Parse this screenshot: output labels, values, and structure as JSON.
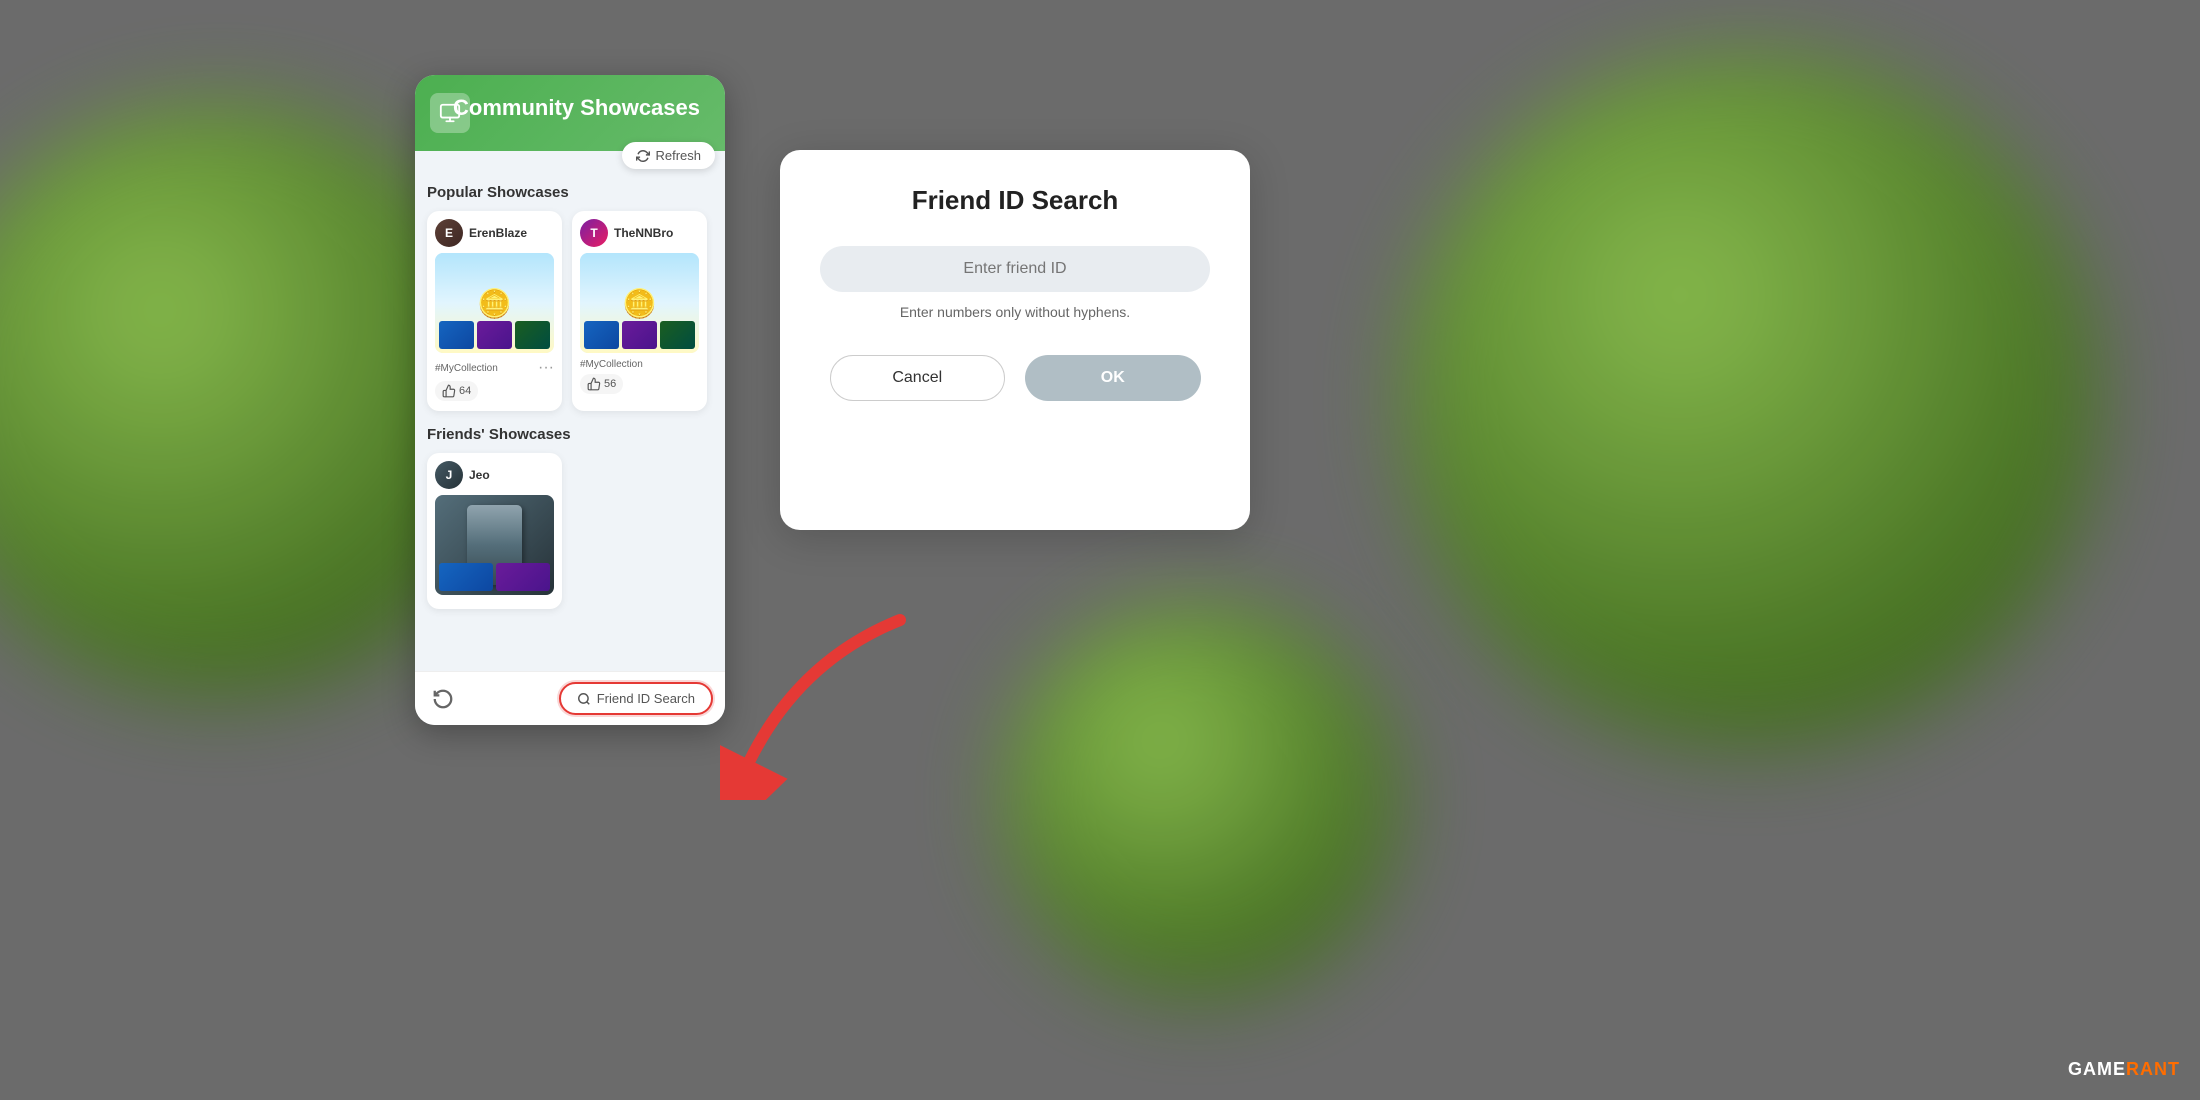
{
  "background": {
    "color": "#6b6b6b"
  },
  "panel": {
    "title": "Community Showcases",
    "refresh_label": "Refresh",
    "popular_showcases_label": "Popular Showcases",
    "friends_showcases_label": "Friends' Showcases",
    "cards": [
      {
        "username": "ErenBlaze",
        "tag": "#MyCollection",
        "likes": "64"
      },
      {
        "username": "TheNNBro",
        "tag": "#MyCollection",
        "likes": "56"
      }
    ],
    "friends": [
      {
        "username": "Jeo"
      }
    ],
    "back_button": "↺",
    "friend_id_search_label": "Friend ID Search"
  },
  "modal": {
    "title": "Friend ID Search",
    "input_placeholder": "Enter friend ID",
    "hint": "Enter numbers only without hyphens.",
    "cancel_label": "Cancel",
    "ok_label": "OK"
  },
  "gamerant": {
    "game": "GAME",
    "rant": "RANT"
  }
}
